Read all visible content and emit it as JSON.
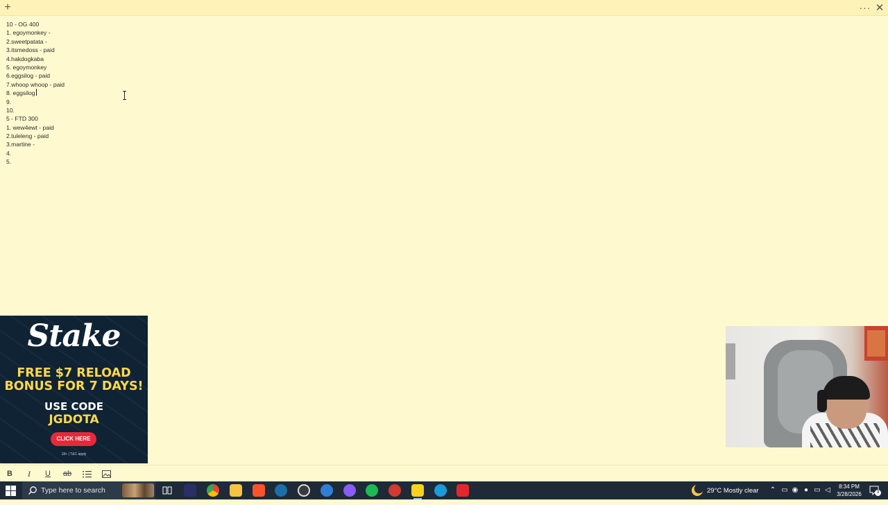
{
  "note": {
    "lines": [
      "10 - OG 400",
      "1. egoymonkey -",
      "2.sweetpatata -",
      "3.itsmedoss - paid",
      "4.hakdogkaba",
      "5. egoymonkey",
      "6.eggsilog - paid",
      "7.whoop whoop - paid",
      "8. eggsilog",
      "9.",
      "10.",
      "5 - FTD 300",
      "1. wew4ewt - paid",
      "2.tuleleng - paid",
      "3.martine -",
      "4.",
      "5."
    ]
  },
  "topbar": {
    "add_icon": "+",
    "more_icon": "···",
    "close_icon": "✕"
  },
  "format_toolbar": {
    "bold": "B",
    "italic": "I",
    "underline": "U",
    "strikethrough": "ab",
    "list_icon": "list-icon",
    "image_icon": "image-icon"
  },
  "ad": {
    "brand": "Stake",
    "headline_1": "FREE $7 RELOAD",
    "headline_2": "BONUS FOR 7 DAYS!",
    "code_label": "USE CODE",
    "code": "JGDOTA",
    "cta": "CLICK HERE",
    "tnc": "18+ | T&C apply"
  },
  "taskbar": {
    "search_placeholder": "Type here to search",
    "weather": "29°C  Mostly clear",
    "time": "8:34 PM",
    "date": "3/28/2026",
    "notification_count": "3",
    "apps": [
      {
        "name": "task-view-icon",
        "color": "#ffffff"
      },
      {
        "name": "visual-studio-icon",
        "color": "#5c6bc0"
      },
      {
        "name": "chrome-icon",
        "color": "#4285f4"
      },
      {
        "name": "file-explorer-icon",
        "color": "#f6c343"
      },
      {
        "name": "brave-icon",
        "color": "#fb542b"
      },
      {
        "name": "steam-icon",
        "color": "#1b6fa8"
      },
      {
        "name": "obs-icon",
        "color": "#3a3a3a"
      },
      {
        "name": "thunderbolt-app-icon",
        "color": "#2f7fd6"
      },
      {
        "name": "messenger-icon",
        "color": "#8a5cf6"
      },
      {
        "name": "spotify-icon",
        "color": "#1db954"
      },
      {
        "name": "dota-icon",
        "color": "#d23a34"
      },
      {
        "name": "sticky-notes-icon",
        "color": "#f7d21e"
      },
      {
        "name": "edge-icon",
        "color": "#1a9cd8"
      },
      {
        "name": "acrobat-icon",
        "color": "#e3262c"
      }
    ]
  }
}
